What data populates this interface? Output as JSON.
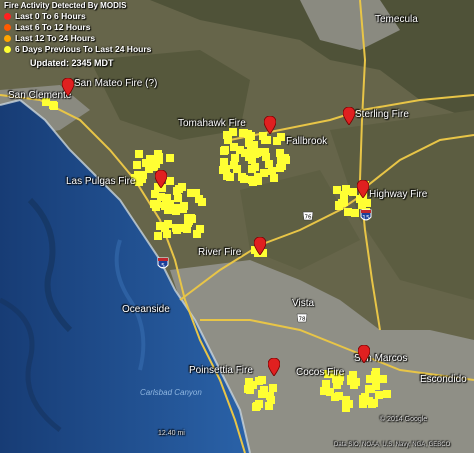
{
  "legend": {
    "title": "Fire Activity Detected By MODIS",
    "items": [
      {
        "label": "Last 0 To 6 Hours",
        "color": "#ff2020"
      },
      {
        "label": "Last 6 To 12 Hours",
        "color": "#ff5a00"
      },
      {
        "label": "Last 12 To 24 Hours",
        "color": "#ffa500"
      },
      {
        "label": "6 Days Previous To Last 24 Hours",
        "color": "#ffff33"
      }
    ],
    "updated": "Updated: 2345 MDT"
  },
  "fires": [
    {
      "id": "san-mateo",
      "name": "San Mateo Fire (?)"
    },
    {
      "id": "tomahawk",
      "name": "Tomahawk Fire"
    },
    {
      "id": "las-pulgas",
      "name": "Las Pulgas Fire"
    },
    {
      "id": "sterling",
      "name": "Sterling Fire"
    },
    {
      "id": "highway",
      "name": "Highway Fire"
    },
    {
      "id": "river",
      "name": "River Fire"
    },
    {
      "id": "poinsettia",
      "name": "Poinsettia Fire"
    },
    {
      "id": "cocos",
      "name": "Cocos Fire"
    }
  ],
  "places": {
    "san_clemente": "San Clemente",
    "temecula": "Temecula",
    "fallbrook": "Fallbrook",
    "oceanside": "Oceanside",
    "vista": "Vista",
    "san_marcos": "San Marcos",
    "escondido": "Escondido"
  },
  "highways": {
    "i5": "5",
    "i15": "15",
    "sr76": "76",
    "sr78": "78"
  },
  "water_label": "Carlsbad Canyon",
  "scale_text": "12.40 mi",
  "attribution": {
    "copyright": "© 2014 Google",
    "data": "Data SIO, NOAA, U.S. Navy, NGA, GEBCO"
  },
  "colors": {
    "ocean": "#1e4d8c",
    "land": "#6b6a4a",
    "urban": "#9a9a92",
    "recent_fire": "#e02020",
    "older_detection": "#ffff33",
    "highway": "#e8c547"
  }
}
